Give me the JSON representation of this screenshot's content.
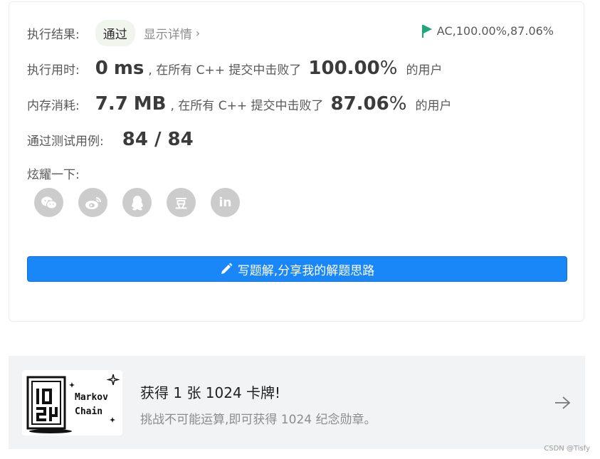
{
  "result": {
    "label": "执行结果:",
    "status": "通过",
    "detail_link": "显示详情",
    "ac_summary": "AC,100.00%,87.06%"
  },
  "runtime": {
    "label": "执行用时:",
    "value": "0",
    "unit": "ms",
    "prefix": ", 在所有 C++ 提交中击败了",
    "percent": "100.00",
    "percent_sign": "%",
    "suffix": "的用户"
  },
  "memory": {
    "label": "内存消耗:",
    "value": "7.7",
    "unit": "MB",
    "prefix": ", 在所有 C++ 提交中击败了",
    "percent": "87.06",
    "percent_sign": "%",
    "suffix": "的用户"
  },
  "testcases": {
    "label": "通过测试用例:",
    "value": "84 / 84"
  },
  "share": {
    "label": "炫耀一下:",
    "buttons": [
      {
        "name": "wechat",
        "icon": "wechat-icon"
      },
      {
        "name": "weibo",
        "icon": "weibo-icon"
      },
      {
        "name": "qq",
        "icon": "qq-icon"
      },
      {
        "name": "douban",
        "icon": "douban-icon",
        "glyph": "豆"
      },
      {
        "name": "linkedin",
        "icon": "linkedin-icon",
        "glyph": "in"
      }
    ]
  },
  "solution_button": {
    "label": "写题解,分享我的解题思路",
    "icon": "pencil-icon"
  },
  "card_banner": {
    "badge_line1": "Markov",
    "badge_line2": "Chain",
    "title": "获得 1 张 1024 卡牌!",
    "subtitle": "挑战不可能运算,即可获得 1024 纪念勋章。",
    "icon": "arrow-right-icon"
  },
  "watermark": "CSDN @Tisfy",
  "colors": {
    "primary_button": "#1a87f8",
    "ac_flag": "#1ea77a",
    "share_button_bg": "#cccccc",
    "banner_bg": "#f2f3f5"
  }
}
